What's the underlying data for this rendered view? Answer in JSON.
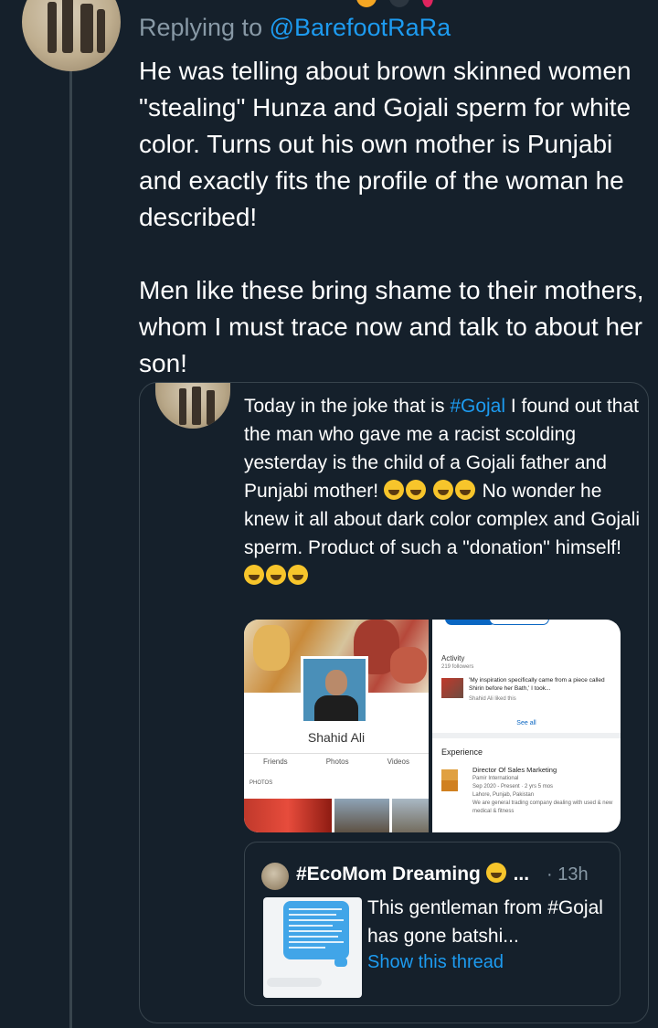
{
  "reply_tweet": {
    "replying_prefix": "Replying to",
    "replying_handle": "@BarefootRaRa",
    "paragraphs": [
      "He was telling about brown skinned women \"stealing\" Hunza and Gojali sperm for white color. Turns out his own mother is Punjabi and exactly fits the profile of the woman he described!",
      "Men like these bring shame to their mothers, whom I must trace now and talk to about her son!"
    ]
  },
  "quoted_tweet": {
    "text_before_hashtag": "Today in the joke that is",
    "hashtag": "#Gojal",
    "text_after_hashtag": "I found out that the man who gave me a racist scolding yesterday is the child of a Gojali father and Punjabi mother!",
    "text_second": "No wonder he knew it all about dark color complex and Gojali sperm. Product of such a \"donation\" himself!",
    "emoji_name": "laughing-emoji",
    "media": {
      "left": {
        "profile_name": "Shahid Ali",
        "tabs": [
          "Friends",
          "Photos",
          "Videos"
        ],
        "photos_label": "PHOTOS"
      },
      "right": {
        "activity_title": "Activity",
        "followers": "219 followers",
        "post_text": "'My inspiration specifically came from a piece called Shirin before her Bath,' I took...",
        "liked": "Shahid Ali liked this",
        "see_all": "See all",
        "experience_title": "Experience",
        "role_title": "Director Of Sales Marketing",
        "company": "Pamir International",
        "dates": "Sep 2020 - Present · 2 yrs 5 mos",
        "location": "Lahore, Punjab, Pakistan",
        "description": "We are general trading company dealing with used & new medical & fitness"
      }
    },
    "nested_tweet": {
      "author": "#EcoMom Dreaming",
      "ellipsis": "...",
      "separator": "·",
      "time": "13h",
      "text": "This gentleman from #Gojal has gone batshi...",
      "show_thread": "Show this thread"
    }
  },
  "colors": {
    "background": "#15202b",
    "text": "#ffffff",
    "muted": "#8899a6",
    "link": "#1d9bf0",
    "border": "#38444d"
  }
}
